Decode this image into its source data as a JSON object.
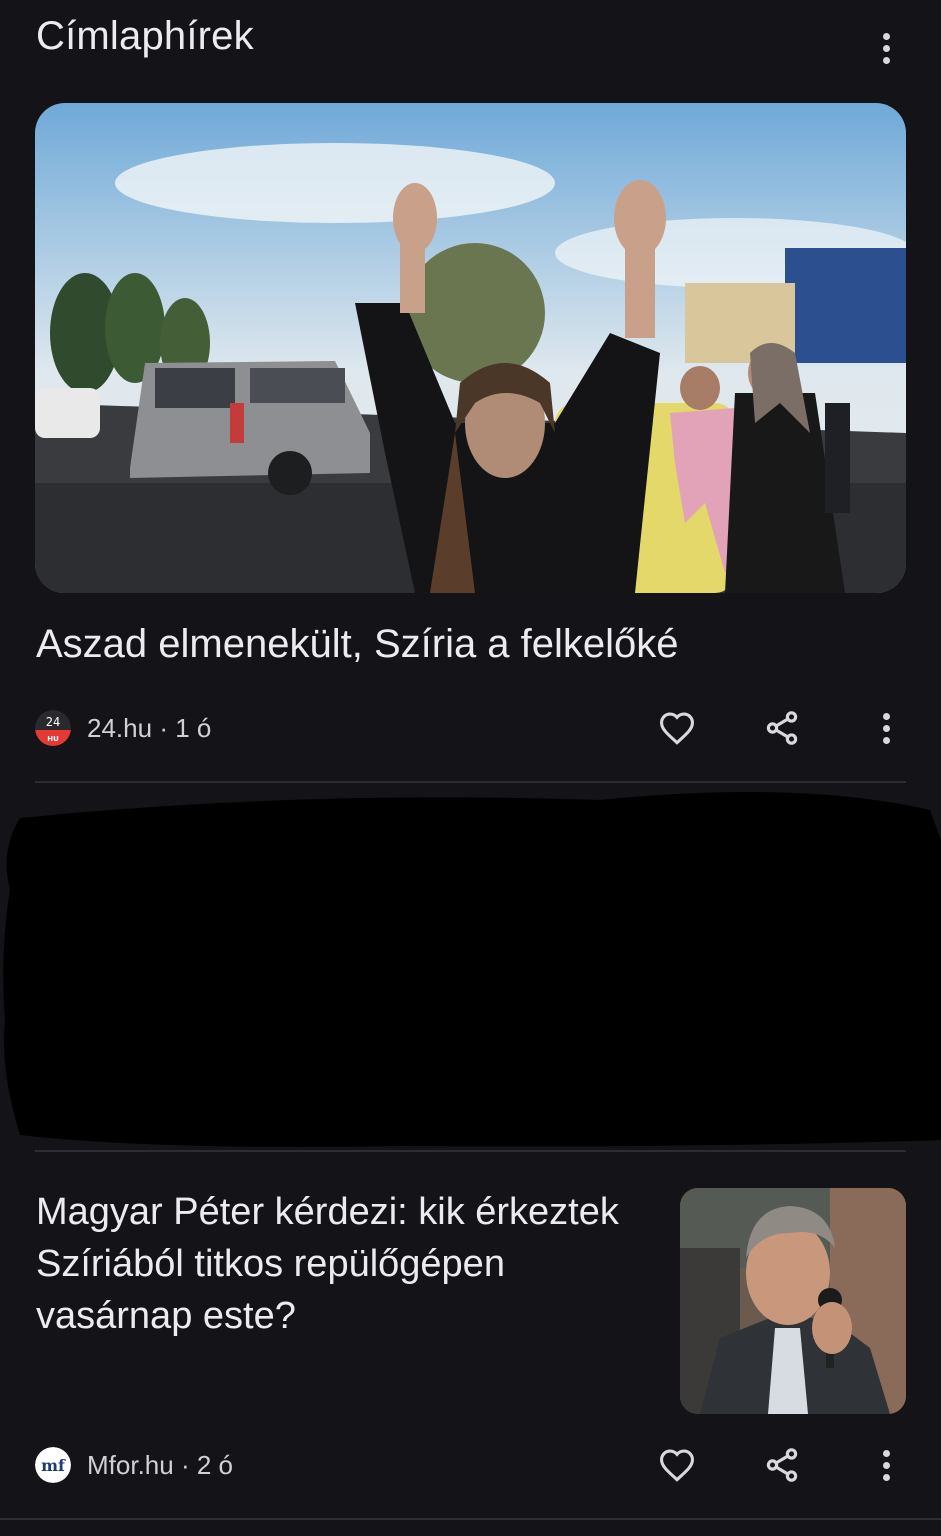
{
  "header": {
    "title": "Címlaphírek"
  },
  "articles": [
    {
      "headline": "Aszad elmenekült, Szíria a felkelőké",
      "source": "24.hu",
      "age": "1 ó",
      "logo_text_top": "24",
      "logo_text_bottom": "HU",
      "image_icon": "photo-crowd-celebrating"
    },
    {
      "headline": "Magyar Péter kérdezi: kik érkeztek Szíriából titkos repülőgépen vasárnap este?",
      "source": "Mfor.hu",
      "age": "2 ó",
      "logo_text": "mf",
      "image_icon": "photo-man-with-microphone"
    }
  ],
  "separator": "·",
  "icons": {
    "like": "heart-icon",
    "share": "share-icon",
    "more": "more-vert-icon"
  },
  "colors": {
    "background": "#131318",
    "text": "#ececf0",
    "meta": "#d0d0d6",
    "brand_24": "#e53935"
  }
}
